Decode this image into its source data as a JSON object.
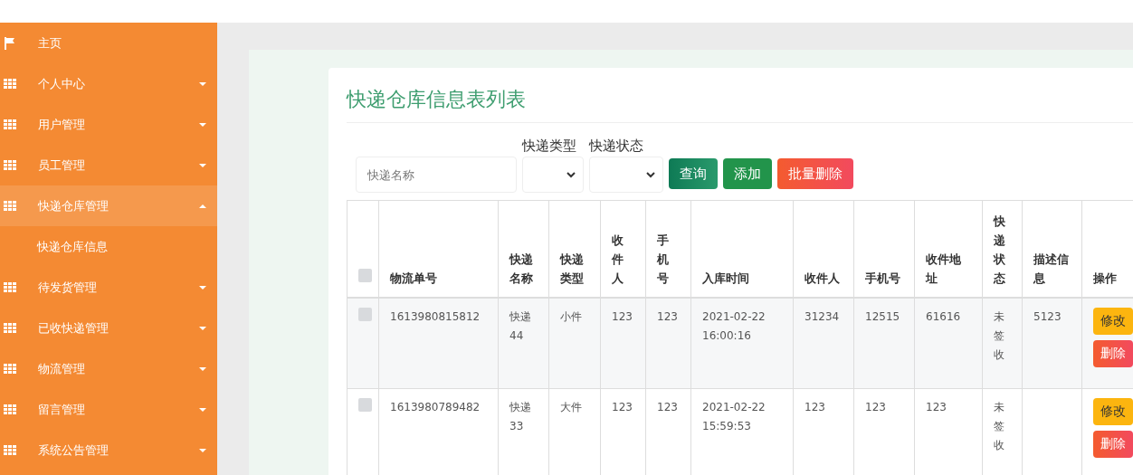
{
  "sidebar": {
    "items": [
      {
        "kind": "link",
        "label": "主页",
        "expanded": false
      },
      {
        "kind": "menu",
        "label": "个人中心",
        "expanded": false
      },
      {
        "kind": "menu",
        "label": "用户管理",
        "expanded": false
      },
      {
        "kind": "menu",
        "label": "员工管理",
        "expanded": false
      },
      {
        "kind": "menu",
        "label": "快递仓库管理",
        "expanded": true,
        "children": [
          {
            "label": "快递仓库信息"
          }
        ]
      },
      {
        "kind": "menu",
        "label": "待发货管理",
        "expanded": false
      },
      {
        "kind": "menu",
        "label": "已收快递管理",
        "expanded": false
      },
      {
        "kind": "menu",
        "label": "物流管理",
        "expanded": false
      },
      {
        "kind": "menu",
        "label": "留言管理",
        "expanded": false
      },
      {
        "kind": "menu",
        "label": "系统公告管理",
        "expanded": false
      }
    ]
  },
  "page": {
    "title": "快递仓库信息表列表",
    "filters": {
      "name": {
        "placeholder": "快递名称"
      },
      "selects": [
        {
          "label": "快递类型"
        },
        {
          "label": "快递状态"
        }
      ],
      "buttons": [
        {
          "kind": "search",
          "label": "查询"
        },
        {
          "kind": "add",
          "label": "添加"
        },
        {
          "kind": "delete",
          "label": "批量删除"
        }
      ]
    },
    "table": {
      "header_checked": false,
      "columns": [
        "物流单号",
        "快递名称",
        "快递类型",
        "收件人",
        "手机号",
        "入库时间",
        "收件人",
        "手机号",
        "收件地址",
        "快递状态",
        "描述信息",
        "操作"
      ],
      "rows": [
        {
          "checked": false,
          "cells": [
            "1613980815812",
            "快递44",
            "小件",
            "123",
            "123",
            "2021-02-22 16:00:16",
            "31234",
            "12515",
            "61616",
            "未签收",
            "5123"
          ],
          "actions": [
            {
              "kind": "edit",
              "label": "修改"
            },
            {
              "kind": "delete",
              "label": "删除"
            }
          ]
        },
        {
          "checked": false,
          "cells": [
            "1613980789482",
            "快递33",
            "大件",
            "123",
            "123",
            "2021-02-22 15:59:53",
            "123",
            "123",
            "123",
            "未签收",
            ""
          ],
          "actions": [
            {
              "kind": "edit",
              "label": "修改"
            },
            {
              "kind": "delete",
              "label": "删除"
            }
          ]
        }
      ]
    }
  }
}
